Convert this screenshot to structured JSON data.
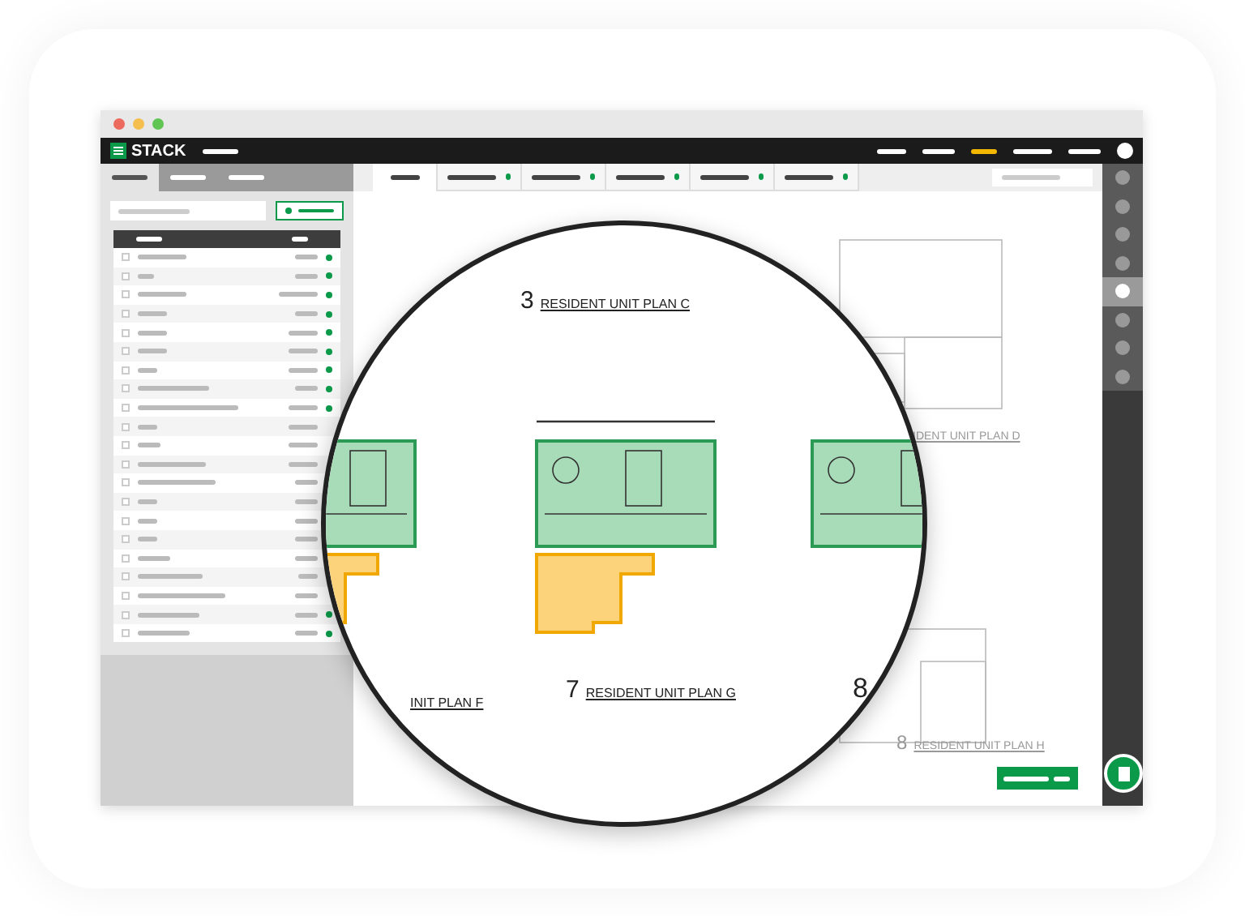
{
  "logo": "STACK",
  "nav": [
    {
      "selected": false
    },
    {
      "selected": false
    },
    {
      "selected": true
    },
    {
      "selected": false
    },
    {
      "selected": false
    }
  ],
  "left_tabs": [
    {
      "selected": true
    },
    {
      "selected": false
    },
    {
      "selected": false
    }
  ],
  "rows": [
    {
      "checked": false,
      "color": "#0a9a4a"
    },
    {
      "checked": false,
      "color": "#0a9a4a"
    },
    {
      "checked": false,
      "color": "#0a9a4a"
    },
    {
      "checked": false,
      "color": "#0a9a4a"
    },
    {
      "checked": false,
      "color": "#0a9a4a"
    },
    {
      "checked": false,
      "color": "#0a9a4a"
    },
    {
      "checked": false,
      "color": "#0a9a4a"
    },
    {
      "checked": false,
      "color": "#0a9a4a"
    },
    {
      "checked": false,
      "color": "#0a9a4a"
    },
    {
      "checked": false
    },
    {
      "checked": false
    },
    {
      "checked": false
    },
    {
      "checked": false
    },
    {
      "checked": false
    },
    {
      "checked": false
    },
    {
      "checked": false
    },
    {
      "checked": false
    },
    {
      "checked": false
    },
    {
      "checked": false
    },
    {
      "checked": false,
      "color": "#0a9a4a"
    },
    {
      "checked": false,
      "color": "#0a9a4a"
    }
  ],
  "plan_tabs": [
    {
      "selected": true
    },
    {
      "selected": false
    },
    {
      "selected": false
    },
    {
      "selected": false
    },
    {
      "selected": false
    },
    {
      "selected": false
    }
  ],
  "rail": [
    {
      "selected": false
    },
    {
      "selected": false
    },
    {
      "selected": false
    },
    {
      "selected": false
    },
    {
      "selected": true
    },
    {
      "selected": false
    },
    {
      "selected": false
    },
    {
      "selected": false
    }
  ],
  "sheet_labels": [
    {
      "text": "IDENT UNIT PLAN D"
    },
    {
      "number": "8",
      "text": "RESIDENT UNIT PLAN H"
    }
  ],
  "magnifier": {
    "labels": [
      {
        "number": "3",
        "text": "RESIDENT UNIT PLAN C"
      },
      {
        "text": "INIT PLAN F"
      },
      {
        "number": "7",
        "text": "RESIDENT UNIT PLAN G"
      },
      {
        "number": "8"
      }
    ]
  }
}
